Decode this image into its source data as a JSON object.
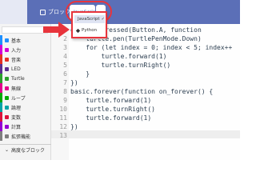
{
  "header": {
    "blocks_label": "ブロック",
    "language_label": "JavaScript",
    "dropdown_caret": "⌄",
    "colors": {
      "bar": "#5b6fb7",
      "highlight": "#e8343c"
    }
  },
  "language_menu": {
    "items": [
      {
        "label": "JavaScript",
        "selected": true,
        "check": "✓"
      },
      {
        "label": "Python",
        "selected": false
      }
    ]
  },
  "sidebar": {
    "categories": [
      {
        "label": "基本",
        "color": "#1e90ff"
      },
      {
        "label": "入力",
        "color": "#d400d4"
      },
      {
        "label": "音楽",
        "color": "#e63022"
      },
      {
        "label": "LED",
        "color": "#5c2d91"
      },
      {
        "label": "Turtle",
        "color": "#2ca02c"
      },
      {
        "label": "無線",
        "color": "#e3008c"
      },
      {
        "label": "ループ",
        "color": "#00aa00"
      },
      {
        "label": "論理",
        "color": "#00a4a6"
      },
      {
        "label": "変数",
        "color": "#dc143c"
      },
      {
        "label": "計算",
        "color": "#9400d3"
      },
      {
        "label": "拡張機能",
        "color": "#7f7f7f"
      }
    ],
    "advanced_label": "高度なブロック"
  },
  "editor": {
    "lines": [
      {
        "num": "1",
        "text": "onButtonPressed(Button.A, function"
      },
      {
        "num": "2",
        "text": "    turtle.pen(TurtlePenMode.Down)"
      },
      {
        "num": "3",
        "text": "    for (let index = 0; index < 5; index++"
      },
      {
        "num": "4",
        "text": "        turtle.forward(1)"
      },
      {
        "num": "5",
        "text": "        turtle.turnRight()"
      },
      {
        "num": "6",
        "text": "    }"
      },
      {
        "num": "7",
        "text": "})"
      },
      {
        "num": "8",
        "text": "basic.forever(function on_forever() {"
      },
      {
        "num": "9",
        "text": "    turtle.forward(1)"
      },
      {
        "num": "10",
        "text": "    turtle.turnRight()"
      },
      {
        "num": "11",
        "text": "    turtle.forward(1)"
      },
      {
        "num": "12",
        "text": "})"
      },
      {
        "num": "13",
        "text": ""
      }
    ]
  }
}
